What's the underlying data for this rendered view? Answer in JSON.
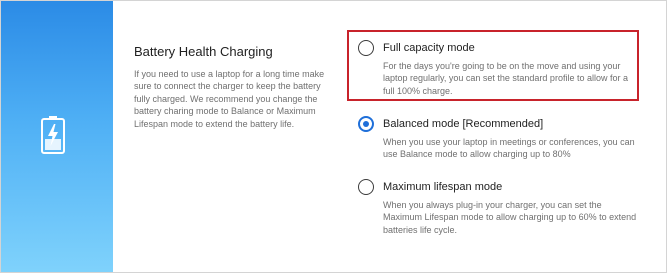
{
  "section": {
    "title": "Battery Health Charging",
    "description": "If you need to use a laptop for a long time make sure to connect the charger to keep the battery fully charged. We recommend you change the battery charing mode to Balance or Maximum Lifespan mode to extend the battery life."
  },
  "options": [
    {
      "title": "Full capacity mode",
      "description": "For the days you're going to be on the move and using your laptop regularly, you can set the standard profile to allow for a full 100% charge.",
      "selected": false
    },
    {
      "title": "Balanced mode [Recommended]",
      "description": "When you use your laptop in meetings or conferences, you can use Balance mode to allow charging up to 80%",
      "selected": true
    },
    {
      "title": "Maximum lifespan mode",
      "description": "When you always plug-in your charger, you can set the Maximum Lifespan mode to allow charging up to 60% to extend batteries life cycle.",
      "selected": false
    }
  ],
  "colors": {
    "accent": "#1f6fd9",
    "highlight": "#c8232b",
    "panel_top": "#2b8be6",
    "panel_bottom": "#7fd2fc"
  },
  "icons": {
    "battery": "battery-charging-icon"
  }
}
